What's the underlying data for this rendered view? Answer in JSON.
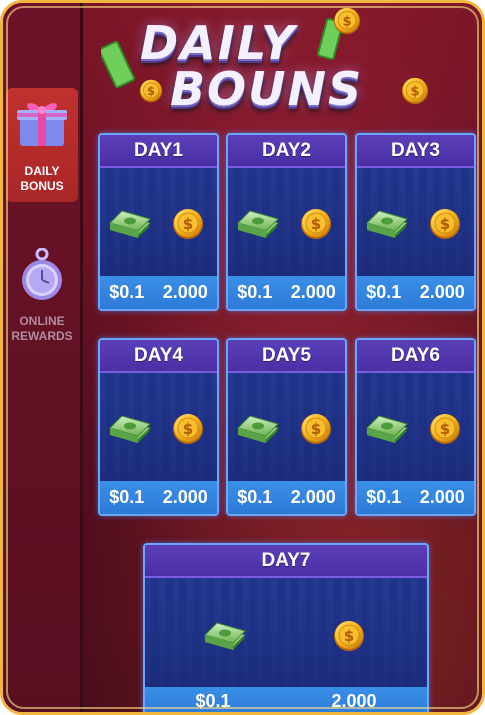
{
  "title": {
    "line1": "DAILY",
    "line2": "BOUNS"
  },
  "sidebar": {
    "items": [
      {
        "label_line1": "DAILY",
        "label_line2": "BONUS",
        "active": true
      },
      {
        "label_line1": "ONLINE",
        "label_line2": "REWARDS",
        "active": false
      }
    ]
  },
  "days": [
    {
      "label": "DAY1",
      "cash": "$0.1",
      "coins": "2.000"
    },
    {
      "label": "DAY2",
      "cash": "$0.1",
      "coins": "2.000"
    },
    {
      "label": "DAY3",
      "cash": "$0.1",
      "coins": "2.000"
    },
    {
      "label": "DAY4",
      "cash": "$0.1",
      "coins": "2.000"
    },
    {
      "label": "DAY5",
      "cash": "$0.1",
      "coins": "2.000"
    },
    {
      "label": "DAY6",
      "cash": "$0.1",
      "coins": "2.000"
    },
    {
      "label": "DAY7",
      "cash": "$0.1",
      "coins": "2.000"
    }
  ],
  "colors": {
    "frame_border": "#f3b63f",
    "card_head": "#4a2fa5",
    "card_foot": "#2d7bd8",
    "active_tab": "#c0312f"
  }
}
